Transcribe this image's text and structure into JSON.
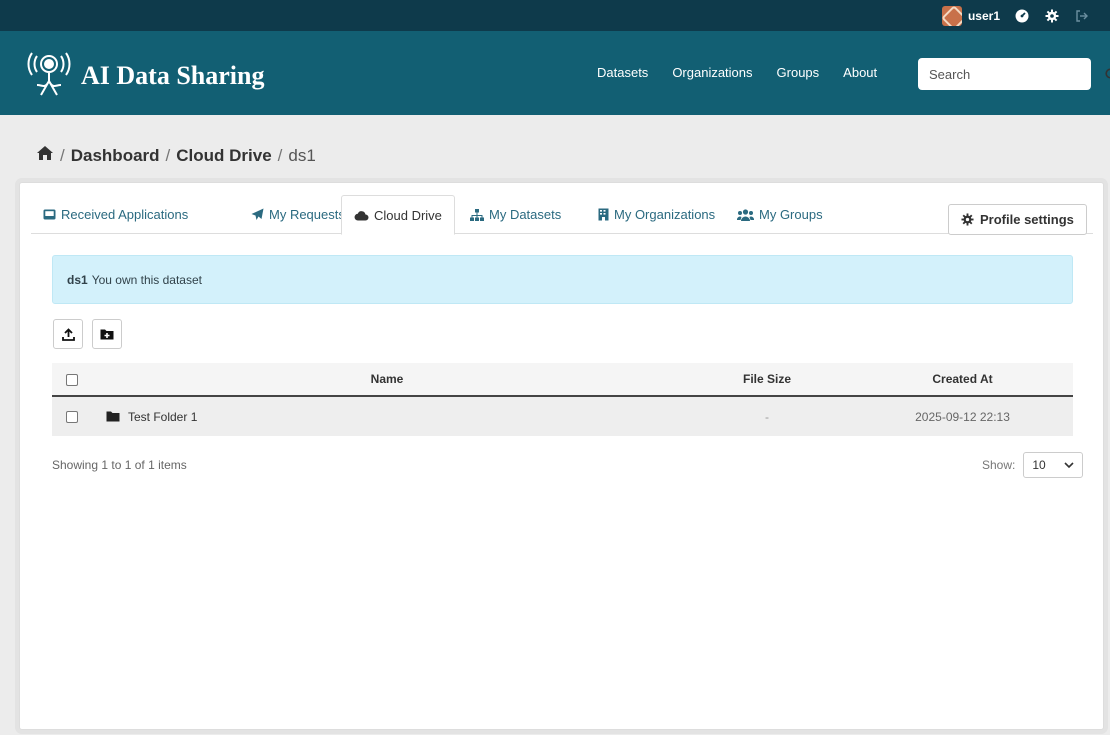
{
  "account": {
    "username": "user1"
  },
  "brand": {
    "title": "AI Data Sharing"
  },
  "nav": [
    "Datasets",
    "Organizations",
    "Groups",
    "About"
  ],
  "search": {
    "placeholder": "Search"
  },
  "breadcrumb": {
    "dashboard": "Dashboard",
    "cloud_drive": "Cloud Drive",
    "current": "ds1"
  },
  "tabs": [
    {
      "label": "Received Applications",
      "icon": "inbox-icon"
    },
    {
      "label": "My Requests",
      "icon": "paper-plane-icon"
    },
    {
      "label": "Cloud Drive",
      "icon": "cloud-icon"
    },
    {
      "label": "My Datasets",
      "icon": "sitemap-icon"
    },
    {
      "label": "My Organizations",
      "icon": "building-icon"
    },
    {
      "label": "My Groups",
      "icon": "users-icon"
    }
  ],
  "active_tab": "Cloud Drive",
  "profile_settings_label": "Profile settings",
  "alert": {
    "dataset": "ds1",
    "message": "You own this dataset"
  },
  "table": {
    "headers": {
      "name": "Name",
      "size": "File Size",
      "created": "Created At"
    },
    "rows": [
      {
        "name": "Test Folder 1",
        "size": "-",
        "created": "2025-09-12 22:13",
        "type": "folder"
      }
    ]
  },
  "pagination": {
    "summary": "Showing 1 to 1 of 1 items",
    "show_label": "Show:",
    "page_size": "10"
  },
  "colors": {
    "topbar": "#0e3a4b",
    "masthead": "#125f73",
    "link": "#2b6a80",
    "alert_bg": "#d3f1fb"
  }
}
